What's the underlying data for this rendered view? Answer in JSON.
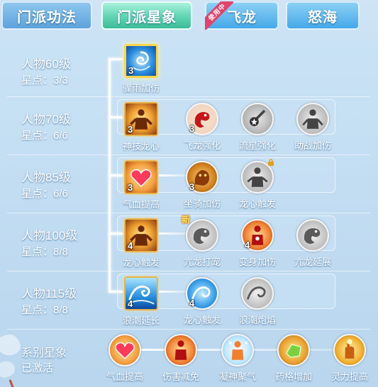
{
  "tabs": [
    {
      "label": "门派功法"
    },
    {
      "label": "门派星象"
    },
    {
      "label": "飞龙",
      "badge": "使用中"
    },
    {
      "label": "怒海"
    }
  ],
  "levels": [
    {
      "title": "人物60级",
      "stars": "星点：3/3"
    },
    {
      "title": "人物70级",
      "stars": "星点：6/6"
    },
    {
      "title": "人物85级",
      "stars": "星点：6/6"
    },
    {
      "title": "人物100级",
      "stars": "星点：8/8"
    },
    {
      "title": "人物115级",
      "stars": "星点：8/8"
    }
  ],
  "skills": {
    "r1": [
      {
        "name": "骤雨加伤",
        "level": "3",
        "icon": "water-swirl-icon"
      }
    ],
    "r2": [
      {
        "name": "神技龙心",
        "level": "3",
        "icon": "glowing-warrior-icon"
      },
      {
        "name": "飞龙强化",
        "level": "3",
        "icon": "red-dragon-icon"
      },
      {
        "name": "流星强化",
        "level": "",
        "icon": "meteor-icon"
      },
      {
        "name": "助战加伤",
        "level": "",
        "icon": "gray-figure-icon"
      }
    ],
    "r3": [
      {
        "name": "气血提高",
        "level": "3",
        "icon": "heart-icon"
      },
      {
        "name": "坐骑加伤",
        "level": "3",
        "icon": "golden-beast-icon"
      },
      {
        "name": "龙心触发",
        "level": "",
        "icon": "locked-figure-icon"
      }
    ],
    "r4": [
      {
        "name": "龙心触发",
        "level": "4",
        "icon": "glowing-warrior-icon"
      },
      {
        "name": "亢龙打宠",
        "level": "",
        "icon": "gray-dragon-icon",
        "new": "新"
      },
      {
        "name": "变身加伤",
        "level": "4",
        "icon": "red-figure-icon"
      },
      {
        "name": "亢龙延展",
        "level": "",
        "icon": "gray-dragon-icon"
      }
    ],
    "r5": [
      {
        "name": "浪潮延长",
        "level": "4",
        "icon": "wave-icon"
      },
      {
        "name": "龙心触发",
        "level": "4",
        "icon": "wave-circle-icon"
      },
      {
        "name": "浪潮炮焰",
        "level": "",
        "icon": "gray-wave-icon"
      }
    ]
  },
  "bottom": {
    "title": "系别星象",
    "status": "已激活",
    "items": [
      {
        "name": "气血提高",
        "icon": "heart-icon"
      },
      {
        "name": "伤害减免",
        "icon": "red-figure-icon"
      },
      {
        "name": "凝神聚气",
        "icon": "snow-figure-icon"
      },
      {
        "name": "药格增加",
        "icon": "green-gem-icon"
      },
      {
        "name": "灵力提高",
        "icon": "golden-hand-icon"
      }
    ]
  },
  "colors": {
    "active_tab": "#5fd4b2",
    "tab": "#45a8e8",
    "badge": "#e2426b"
  }
}
